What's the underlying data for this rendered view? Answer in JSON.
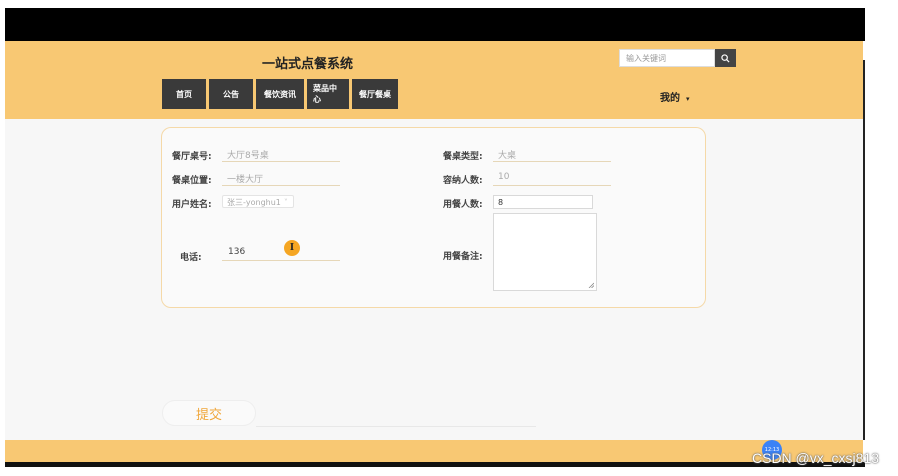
{
  "header": {
    "title": "一站式点餐系统",
    "search_placeholder": "输入关键词",
    "mine_label": "我的",
    "nav": [
      {
        "label": "首页"
      },
      {
        "label": "公告"
      },
      {
        "label": "餐饮资讯"
      },
      {
        "label": "菜品中心"
      },
      {
        "label": "餐厅餐桌"
      }
    ]
  },
  "form": {
    "table_no_label": "餐厅桌号:",
    "table_no_value": "大厅8号桌",
    "table_type_label": "餐桌类型:",
    "table_type_value": "大桌",
    "location_label": "餐桌位置:",
    "location_value": "一楼大厅",
    "capacity_label": "容纳人数:",
    "capacity_value": "10",
    "username_label": "用户姓名:",
    "username_value": "张三-yonghu1",
    "diners_label": "用餐人数:",
    "diners_value": "8",
    "phone_label": "电话:",
    "phone_value": "136",
    "remark_label": "用餐备注:",
    "remark_value": "",
    "submit_label": "提交"
  },
  "overlay": {
    "cursor_glyph": "I",
    "badge_text": "12:13",
    "watermark": "CSDN @vx_cxsj813"
  },
  "colors": {
    "header_bg": "#f8c873",
    "nav_bg": "#3a3a3a",
    "accent": "#f0a63a"
  }
}
